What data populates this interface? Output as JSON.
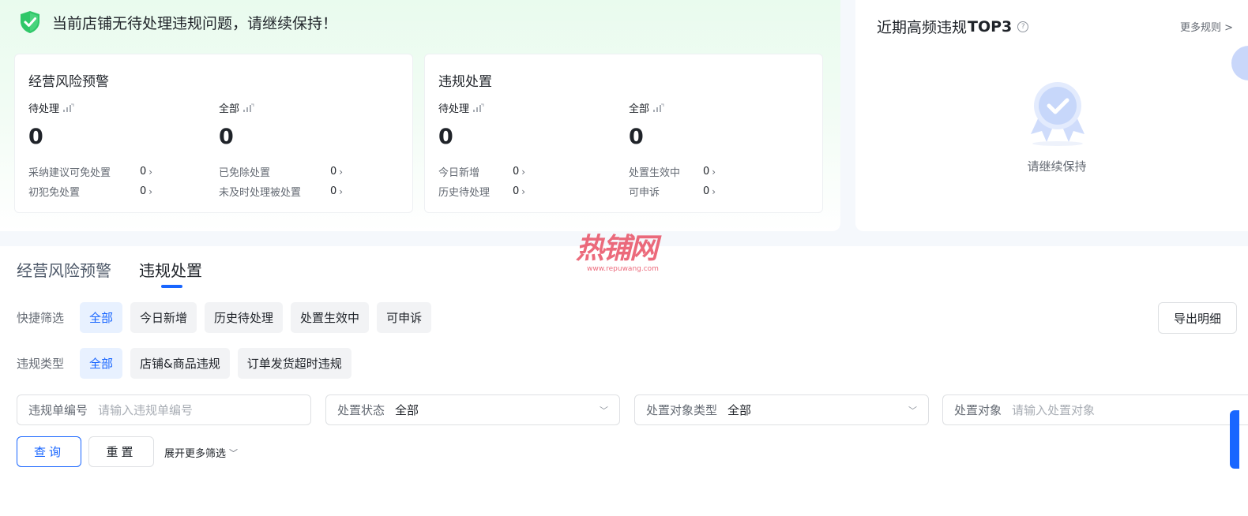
{
  "status": {
    "message": "当前店铺无待处理违规问题，请继续保持！"
  },
  "cards": [
    {
      "title": "经营风险预警",
      "columns": [
        {
          "label": "待处理",
          "value": "0",
          "rows": [
            {
              "label": "采纳建议可免处置",
              "value": "0"
            },
            {
              "label": "初犯免处置",
              "value": "0"
            }
          ]
        },
        {
          "label": "全部",
          "value": "0",
          "rows": [
            {
              "label": "已免除处置",
              "value": "0"
            },
            {
              "label": "未及时处理被处置",
              "value": "0"
            }
          ]
        }
      ]
    },
    {
      "title": "违规处置",
      "columns": [
        {
          "label": "待处理",
          "value": "0",
          "rows": [
            {
              "label": "今日新增",
              "value": "0"
            },
            {
              "label": "历史待处理",
              "value": "0"
            }
          ]
        },
        {
          "label": "全部",
          "value": "0",
          "rows": [
            {
              "label": "处置生效中",
              "value": "0"
            },
            {
              "label": "可申诉",
              "value": "0"
            }
          ]
        }
      ]
    }
  ],
  "top3": {
    "title_prefix": "近期高频违规",
    "title_bold": "TOP3",
    "help": "?",
    "more": "更多规则 >",
    "empty_text": "请继续保持"
  },
  "watermark": {
    "main": "热铺网",
    "sub": "www.repuwang.com"
  },
  "tabs": [
    {
      "label": "经营风险预警",
      "active": false
    },
    {
      "label": "违规处置",
      "active": true
    }
  ],
  "quick_filter": {
    "label": "快捷筛选",
    "chips": [
      "全部",
      "今日新增",
      "历史待处理",
      "处置生效中",
      "可申诉"
    ],
    "active_index": 0
  },
  "type_filter": {
    "label": "违规类型",
    "chips": [
      "全部",
      "店铺&商品违规",
      "订单发货超时违规"
    ],
    "active_index": 0
  },
  "export_label": "导出明细",
  "fields": {
    "violation_no": {
      "label": "违规单编号",
      "placeholder": "请输入违规单编号"
    },
    "status": {
      "label": "处置状态",
      "value": "全部"
    },
    "target_type": {
      "label": "处置对象类型",
      "value": "全部"
    },
    "target": {
      "label": "处置对象",
      "placeholder": "请输入处置对象"
    }
  },
  "buttons": {
    "query": "查询",
    "reset": "重置",
    "expand": "展开更多筛选"
  },
  "colors": {
    "primary": "#1966ff",
    "success": "#28c76f",
    "text": "#1f2329",
    "muted": "#646a73"
  }
}
